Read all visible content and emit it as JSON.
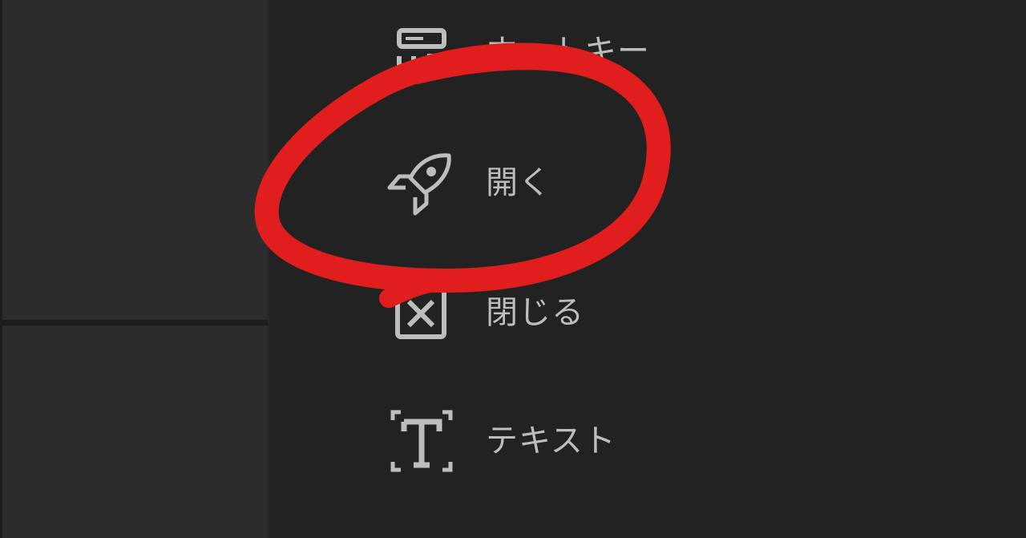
{
  "colors": {
    "background": "#222222",
    "left_panel": "#2c2c2c",
    "divider": "#1c1c1c",
    "item_text": "#bdbdbd",
    "icon_stroke": "#bdbdbd",
    "annotation": "#e01e1e"
  },
  "menu": {
    "items": [
      {
        "label": "ホットキー",
        "icon": "hotkey-icon"
      },
      {
        "label": "開く",
        "icon": "rocket-icon"
      },
      {
        "label": "閉じる",
        "icon": "close-box-icon"
      },
      {
        "label": "テキスト",
        "icon": "text-frame-icon"
      }
    ]
  },
  "annotation": {
    "shape": "hand-drawn-circle",
    "target": "開く"
  }
}
